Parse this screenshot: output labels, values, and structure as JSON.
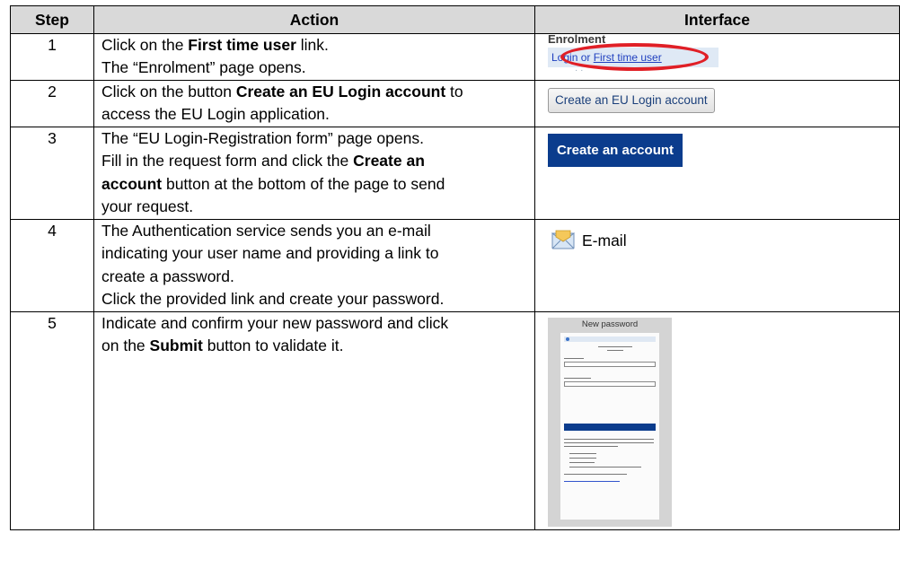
{
  "headers": {
    "step": "Step",
    "action": "Action",
    "interface": "Interface"
  },
  "rows": [
    {
      "step": "1",
      "lines": [
        [
          {
            "t": "Click on the "
          },
          {
            "t": "First time user",
            "b": true
          },
          {
            "t": " link."
          }
        ],
        [
          {
            "t": "The “Enrolment” page opens."
          }
        ]
      ],
      "interface": {
        "kind": "enrolment",
        "title": "Enrolment",
        "text_prefix": "Login or ",
        "link_text": "First time user"
      }
    },
    {
      "step": "2",
      "lines": [
        [
          {
            "t": "Click on the button "
          },
          {
            "t": "Create an EU Login account",
            "b": true
          },
          {
            "t": " to"
          }
        ],
        [
          {
            "t": "access the EU Login application."
          }
        ]
      ],
      "interface": {
        "kind": "button",
        "label": "Create an EU Login account"
      }
    },
    {
      "step": "3",
      "lines": [
        [
          {
            "t": "The “EU Login-Registration form” page opens."
          }
        ],
        [
          {
            "t": "Fill in the request form and click the "
          },
          {
            "t": "Create an",
            "b": true
          }
        ],
        [
          {
            "t": "account",
            "b": true
          },
          {
            "t": " button at the bottom of the page to send"
          }
        ],
        [
          {
            "t": "your request."
          }
        ]
      ],
      "interface": {
        "kind": "create",
        "label": "Create an account"
      }
    },
    {
      "step": "4",
      "lines": [
        [
          {
            "t": "The Authentication service sends you an e-mail"
          }
        ],
        [
          {
            "t": "indicating your user name and providing a link to"
          }
        ],
        [
          {
            "t": "create a password."
          }
        ],
        [
          {
            "t": "Click the provided link and create your password."
          }
        ]
      ],
      "interface": {
        "kind": "email",
        "label": "E-mail",
        "icon": "envelope-icon"
      }
    },
    {
      "step": "5",
      "lines": [
        [
          {
            "t": "Indicate and confirm your new password and click"
          }
        ],
        [
          {
            "t": "on the "
          },
          {
            "t": "Submit",
            "b": true
          },
          {
            "t": " button to validate it."
          }
        ]
      ],
      "interface": {
        "kind": "password",
        "title": "New password"
      }
    }
  ],
  "colors": {
    "header_bg": "#d9d9d9",
    "brand_blue": "#0b3c8d",
    "highlight_red": "#e01f26"
  }
}
